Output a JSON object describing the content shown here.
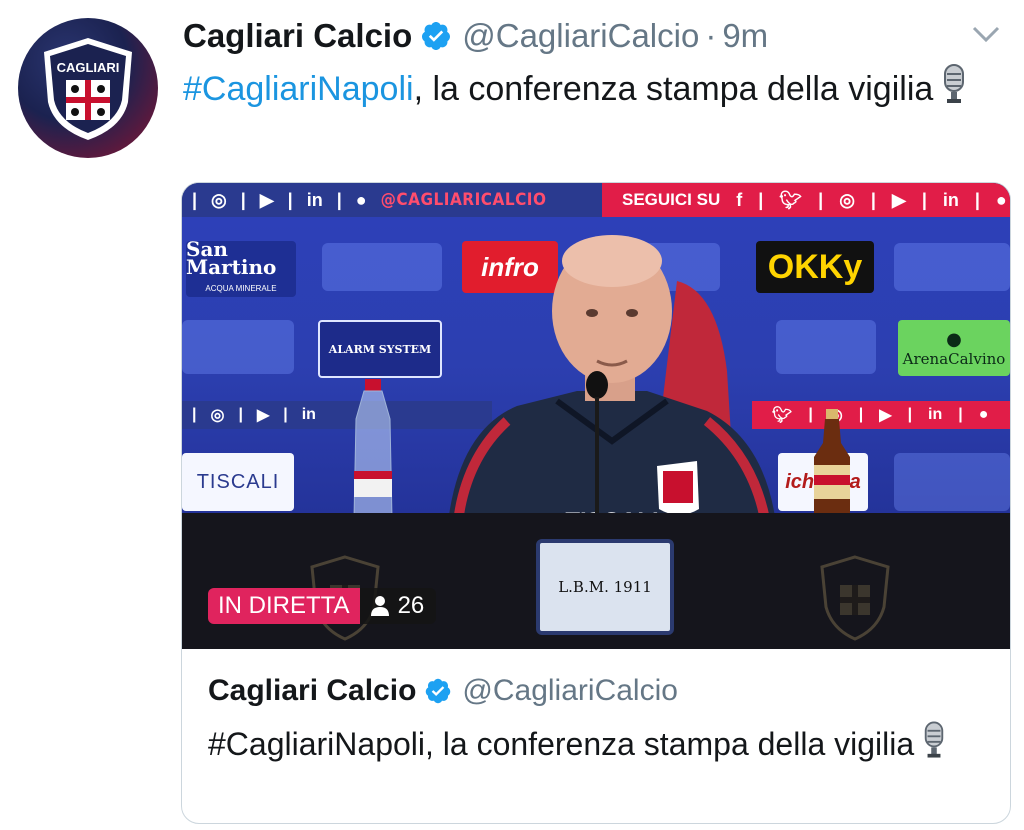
{
  "tweet": {
    "display_name": "Cagliari Calcio",
    "handle": "@CagliariCalcio",
    "separator": "·",
    "time": "9m",
    "hashtag": "#CagliariNapoli",
    "text_rest": ", la conferenza stampa della vigilia",
    "avatar_text": "CAGLIARI",
    "verified_icon": "verified-badge-icon",
    "mic_icon": "microphone-emoji-icon",
    "menu_icon": "chevron-down-icon"
  },
  "card": {
    "display_name": "Cagliari Calcio",
    "handle": "@CagliariCalcio",
    "hashtag": "#CagliariNapoli",
    "text_rest": ", la conferenza stampa della vigilia",
    "live_label": "IN DIRETTA",
    "viewers": "26",
    "viewer_icon": "person-icon"
  },
  "backdrop": {
    "top_handle": "@CAGLIARICALCIO",
    "seguici": "SEGUICI SU",
    "sponsors": {
      "san_martino": "San Martino",
      "san_martino_sub": "ACQUA MINERALE",
      "infront": "infro",
      "okky": "OKKy",
      "alarm": "ALARM SYSTEM",
      "arena": "ArenaCalvino",
      "tiscali": "TISCALI",
      "ichnusa": "ichnusa"
    },
    "plaque": "L.B.M. 1911",
    "shirt_text": "TISCALI",
    "social_in": "in"
  },
  "colors": {
    "link": "#1b95e0",
    "live": "#e0245e",
    "verified": "#1da1f2",
    "muted": "#657786"
  }
}
